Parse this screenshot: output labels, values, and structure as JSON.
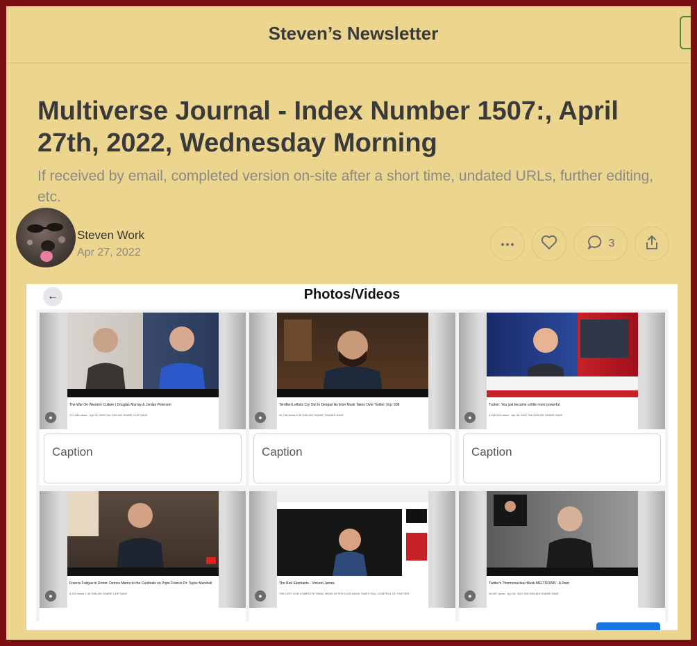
{
  "publication": {
    "name": "Steven’s Newsletter"
  },
  "post": {
    "title": "Multiverse Journal - Index Number 1507:, April 27th, 2022, Wednesday Morning",
    "subtitle": "If received by email, completed version on-site after a short time, undated URLs, further editing, etc.",
    "author": "Steven Work",
    "date": "Apr 27, 2022",
    "comment_count": "3"
  },
  "embed": {
    "title": "Photos/Videos",
    "caption_placeholder": "Caption",
    "cards": [
      {
        "title": "The War On Western Culture | Douglas Murray & Jordan Peterson",
        "stats": "272,296 views · Apr 25, 2022   11K   DISLIKE   SHARE   CLIP   SAVE"
      },
      {
        "title": "Terrified Leftists Cry Out In Despair As Elon Musk Takes Over Twitter | Ep. 938",
        "stats": "40,738 views   5.2K   DISLIKE   SHARE   THANKS   SAVE"
      },
      {
        "title": "Tucker: You just became a little more powerful",
        "stats": "1,518,206 views · Apr 26, 2022   76K   DISLIKE   SHARE   SAVE"
      },
      {
        "title": "Francis Fatigue in Rome: Demos Memo to the Cardinals on Pope Francis Dr. Taylor Marshall",
        "stats": "6,229 views   1.3K   DISLIKE   SHARE   CLIP   SAVE"
      },
      {
        "title": "The Red Elephants - Vincent James",
        "stats": "THE LEFT IS IN COMPLETE PANIC MODE AFTER ELON MUSK TAKES FULL CONTROL OF TWITTER"
      },
      {
        "title": "Twitter's Thermonuclear Musk MELTDOWN - A Rant",
        "stats": "96,597 views · Apr 26, 2022   10K   DISLIKE   SHARE   SAVE"
      }
    ]
  },
  "colors": {
    "frame": "#7a0f14",
    "page_bg": "#ecd58e",
    "accent_button": "#1b74e4"
  }
}
